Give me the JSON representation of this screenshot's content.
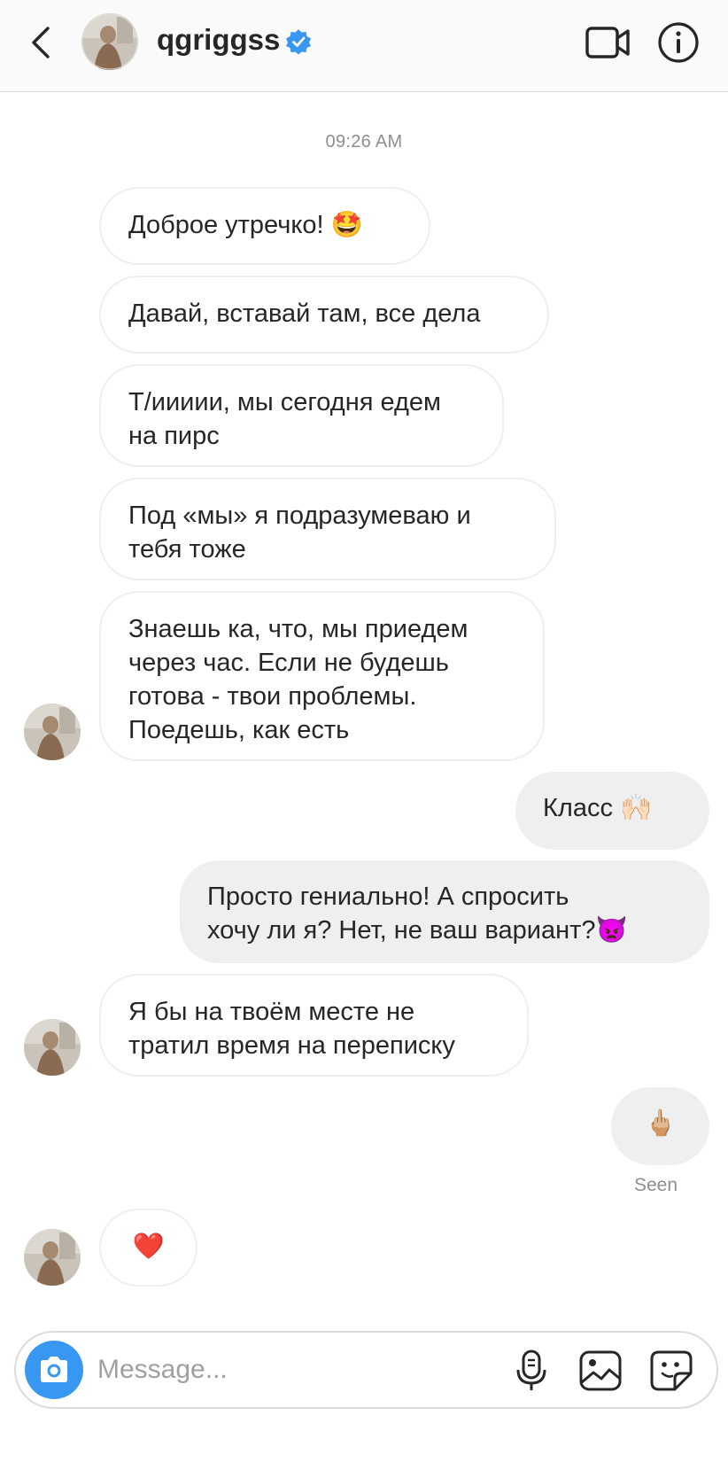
{
  "header": {
    "username": "qgriggss",
    "verified": true
  },
  "timestamp": "09:26 AM",
  "messages": [
    {
      "direction": "incoming",
      "text": "Доброе утречко! 🤩"
    },
    {
      "direction": "incoming",
      "text": "Давай, вставай там, все дела"
    },
    {
      "direction": "incoming",
      "text": "Т/иииии, мы сегодня едем\nна пирс"
    },
    {
      "direction": "incoming",
      "text": "Под «мы» я подразумеваю и\nтебя тоже"
    },
    {
      "direction": "incoming",
      "text": "Знаешь ка, что, мы приедем\nчерез час. Если не будешь\nготова - твои проблемы.\nПоедешь, как есть"
    },
    {
      "direction": "outgoing",
      "text": "Класс 🙌🏻"
    },
    {
      "direction": "outgoing",
      "text": "Просто гениально! А спросить\nхочу ли я? Нет, не ваш вариант?👿"
    },
    {
      "direction": "incoming",
      "text": "Я бы на твоём месте не\nтратил время на переписку"
    },
    {
      "direction": "outgoing",
      "text": "🖕🏼"
    },
    {
      "direction": "incoming",
      "text": "❤️"
    }
  ],
  "seen_label": "Seen",
  "composer": {
    "placeholder": "Message..."
  },
  "colors": {
    "accent": "#3897f0",
    "outgoing_bubble": "#efefef",
    "incoming_border": "#efefef",
    "secondary_text": "#8e8e8e"
  }
}
